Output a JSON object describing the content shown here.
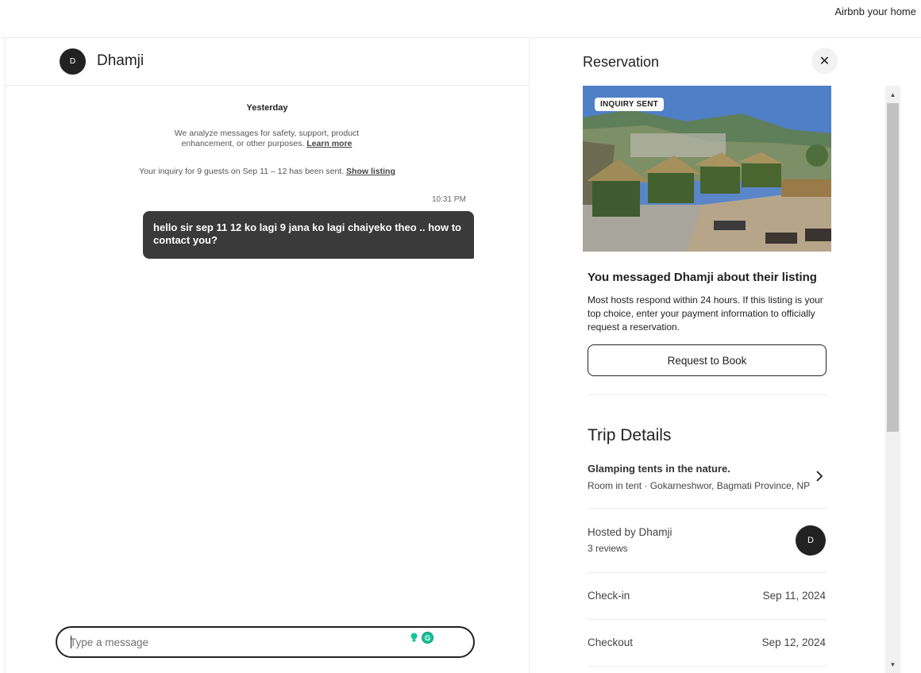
{
  "topbar": {
    "host_link": "Airbnb your home"
  },
  "chat": {
    "host_initial": "D",
    "host_name": "Dhamji",
    "day_label": "Yesterday",
    "notice_text": "We analyze messages for safety, support, product enhancement, or other purposes.",
    "notice_link": "Learn more",
    "inquiry_text": "Your inquiry for 9 guests on Sep 11 – 12 has been sent.",
    "inquiry_link": "Show listing",
    "messages": [
      {
        "time": "10:31 PM",
        "text": "hello sir sep 11 12 ko lagi 9 jana ko lagi chaiyeko theo .. how to contact you?"
      }
    ],
    "composer_placeholder": "Type a message"
  },
  "reservation": {
    "title": "Reservation",
    "close_icon": "close-icon",
    "badge": "INQUIRY SENT",
    "message_title": "You messaged Dhamji about their listing",
    "message_body": "Most hosts respond within 24 hours. If this listing is your top choice, enter your payment information to officially request a reservation.",
    "book_button": "Request to Book",
    "trip_title": "Trip Details",
    "listing_name": "Glamping tents in the nature.",
    "listing_sub": "Room in tent · Gokarneshwor, Bagmati Province, NP",
    "hosted_by": "Hosted by Dhamji",
    "reviews": "3 reviews",
    "host_initial": "D",
    "checkin_label": "Check-in",
    "checkin_value": "Sep 11, 2024",
    "checkout_label": "Checkout",
    "checkout_value": "Sep 12, 2024"
  },
  "colors": {
    "bubble": "#3a3a3a",
    "avatar": "#222222",
    "grammarly": "#15c39a"
  }
}
